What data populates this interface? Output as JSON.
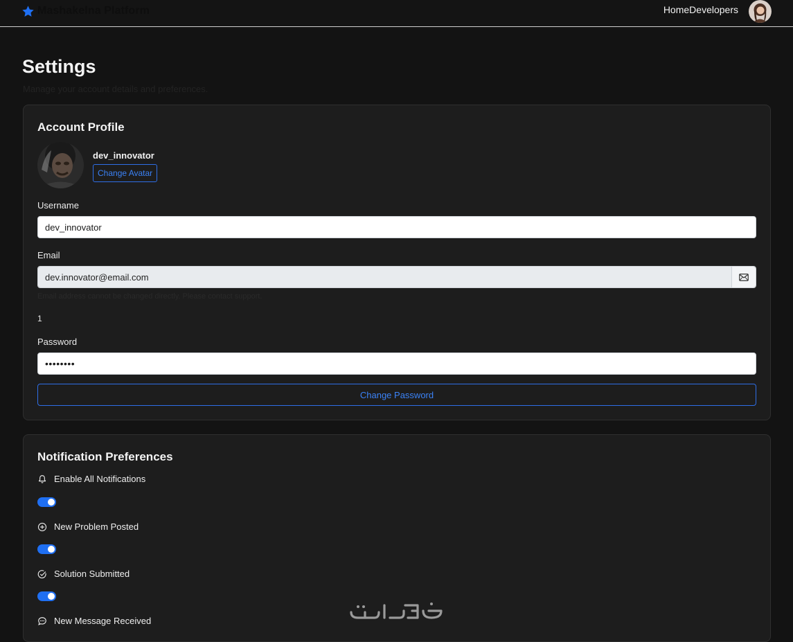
{
  "brand": {
    "name": "Mashakelna Platform",
    "icon": "star-icon",
    "color": "#1f6ff2"
  },
  "nav": {
    "links": [
      "Home",
      "Developers"
    ],
    "avatar": "user-avatar"
  },
  "page": {
    "title": "Settings",
    "subtitle": "Manage your account details and preferences."
  },
  "profile": {
    "title": "Account Profile",
    "username_display": "dev_innovator",
    "change_avatar_label": "Change Avatar",
    "username_label": "Username",
    "username_value": "dev_innovator",
    "email_label": "Email",
    "email_value": "dev.innovator@email.com",
    "email_icon": "envelope-icon",
    "email_help": "Email address cannot be changed directly. Please contact support.",
    "stray_text": "1",
    "password_label": "Password",
    "password_value": "••••••••",
    "change_password_label": "Change Password"
  },
  "notifications": {
    "title": "Notification Preferences",
    "items": [
      {
        "label": "Enable All Notifications",
        "icon": "bell-icon",
        "enabled": true
      },
      {
        "label": "New Problem Posted",
        "icon": "plus-circle-icon",
        "enabled": true
      },
      {
        "label": "Solution Submitted",
        "icon": "check-circle-icon",
        "enabled": true
      },
      {
        "label": "New Message Received",
        "icon": "chat-bubble-icon",
        "enabled": true
      }
    ]
  },
  "colors": {
    "accent": "#1f6ff2",
    "background": "#131313",
    "card": "#1d1d1d"
  },
  "watermark": "خمسات"
}
